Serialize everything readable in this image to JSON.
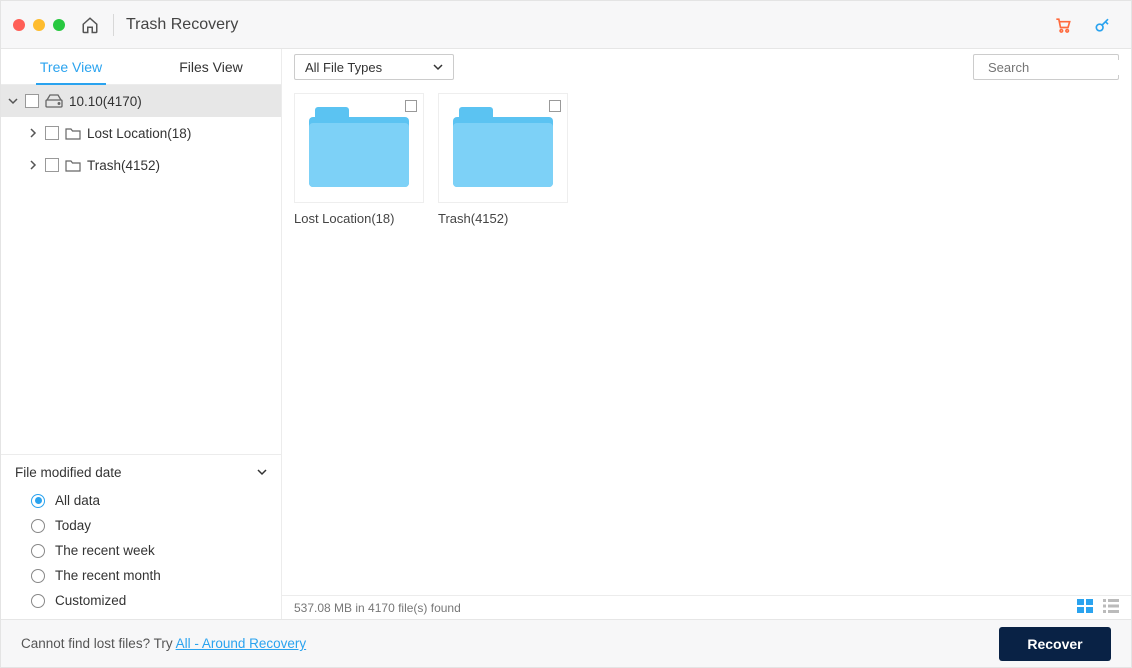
{
  "window": {
    "title": "Trash Recovery"
  },
  "sidebar": {
    "tabs": {
      "tree": "Tree View",
      "files": "Files View"
    },
    "tree": {
      "root": "10.10(4170)",
      "children": [
        {
          "label": "Lost Location(18)"
        },
        {
          "label": "Trash(4152)"
        }
      ]
    },
    "filter": {
      "title": "File modified date",
      "options": [
        "All data",
        "Today",
        "The recent week",
        "The recent month",
        "Customized"
      ],
      "selected": "All data"
    }
  },
  "toolbar": {
    "file_types": "All File Types",
    "search_placeholder": "Search"
  },
  "grid": {
    "items": [
      {
        "label": "Lost Location(18)"
      },
      {
        "label": "Trash(4152)"
      }
    ]
  },
  "status": {
    "text": "537.08 MB in 4170 file(s) found"
  },
  "footer": {
    "prefix": "Cannot find lost files? Try ",
    "link": "All - Around Recovery",
    "recover": "Recover"
  }
}
